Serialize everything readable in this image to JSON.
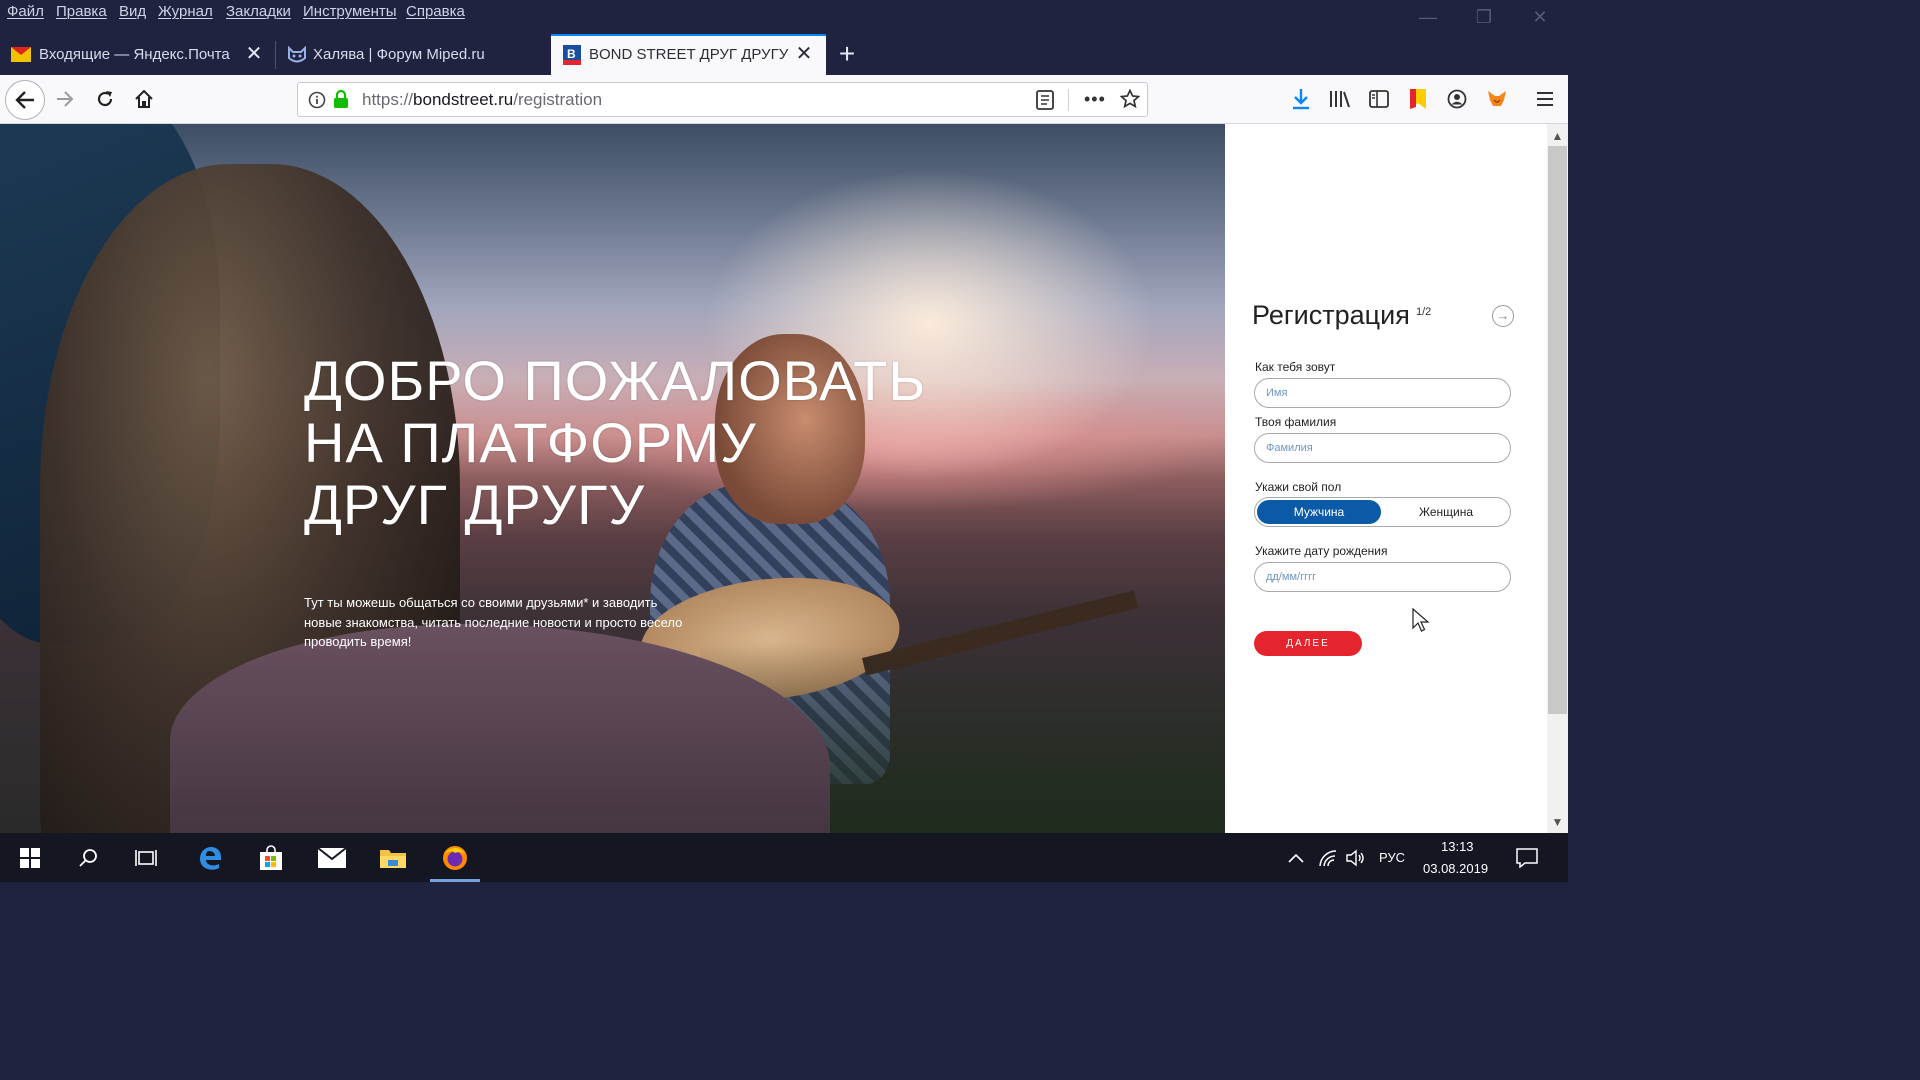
{
  "menubar": {
    "items": [
      "Файл",
      "Правка",
      "Вид",
      "Журнал",
      "Закладки",
      "Инструменты",
      "Справка"
    ]
  },
  "window_controls": {
    "minimize": "—",
    "restore": "❐",
    "close": "✕"
  },
  "tabs": [
    {
      "title": "Входящие — Яндекс.Почта",
      "icon": "yandex-mail-icon",
      "active": false
    },
    {
      "title": "Халява | Форум Miped.ru",
      "icon": "miped-forum-icon",
      "active": false
    },
    {
      "title": "BOND STREET ДРУГ ДРУГУ",
      "icon": "bondstreet-icon",
      "active": true
    }
  ],
  "addressbar": {
    "scheme": "https://",
    "host": "bondstreet.ru",
    "path": "/registration"
  },
  "hero": {
    "title": "ДОБРО ПОЖАЛОВАТЬ\nНА ПЛАТФОРМУ\nДРУГ ДРУГУ",
    "text": "Тут ты можешь общаться со своими друзьями* и заводить новые знакомства, читать последние новости и просто весело проводить время!"
  },
  "registration": {
    "title": "Регистрация",
    "step": "1/2",
    "first_name_label": "Как тебя зовут",
    "first_name_placeholder": "Имя",
    "last_name_label": "Твоя фамилия",
    "last_name_placeholder": "Фамилия",
    "gender_label": "Укажи свой пол",
    "gender_male": "Мужчина",
    "gender_female": "Женщина",
    "gender_selected": "Мужчина",
    "birthdate_label": "Укажите дату рождения",
    "birthdate_placeholder": "дд/мм/гггг",
    "next_button": "ДАЛЕЕ"
  },
  "taskbar": {
    "language": "РУС",
    "time": "13:13",
    "date": "03.08.2019"
  },
  "colors": {
    "accent_red": "#e4252e",
    "accent_blue": "#0a5aa8",
    "tab_highlight": "#0a84ff"
  }
}
